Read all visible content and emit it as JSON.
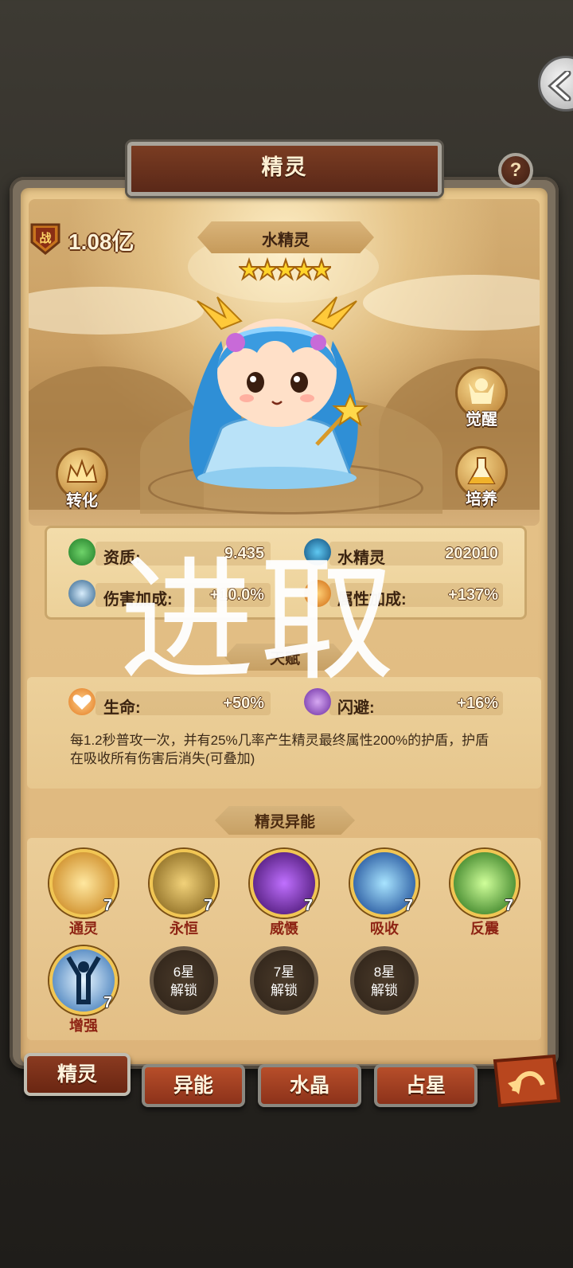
{
  "window": {
    "title": "精灵"
  },
  "power": {
    "badge": "战",
    "value": "1.08亿"
  },
  "spirit": {
    "name": "水精灵",
    "stars": 5
  },
  "side_buttons": {
    "awaken": "觉醒",
    "transform": "转化",
    "cultivate": "培养"
  },
  "stats": {
    "aptitude_label": "资质:",
    "aptitude_value": "9.435",
    "element_label": "水精灵",
    "element_value": "202010",
    "damage_label": "伤害加成:",
    "damage_value": "+10.0%",
    "attribute_label": "属性加成:",
    "attribute_value": "+137%"
  },
  "talent": {
    "title": "天赋",
    "hp_label": "生命:",
    "hp_value": "+50%",
    "dodge_label": "闪避:",
    "dodge_value": "+16%",
    "description": "每1.2秒普攻一次，并有25%几率产生精灵最终属性200%的护盾，护盾在吸收所有伤害后消失(可叠加)"
  },
  "skills": {
    "title": "精灵异能",
    "items": [
      {
        "name": "通灵",
        "level": "7",
        "icon": "magic-circle-icon",
        "color": "#e3a21c"
      },
      {
        "name": "永恒",
        "level": "7",
        "icon": "golden-helmet-icon",
        "color": "#9a7a26"
      },
      {
        "name": "威慑",
        "level": "7",
        "icon": "demon-icon",
        "color": "#6a1fa0"
      },
      {
        "name": "吸收",
        "level": "7",
        "icon": "blue-sword-icon",
        "color": "#1f5fc8"
      },
      {
        "name": "反震",
        "level": "7",
        "icon": "green-blade-icon",
        "color": "#3c9b1e"
      },
      {
        "name": "增强",
        "level": "7",
        "icon": "empower-figure-icon",
        "color": "#4b8fd8"
      }
    ],
    "locked": [
      {
        "line1": "6星",
        "line2": "解锁"
      },
      {
        "line1": "7星",
        "line2": "解锁"
      },
      {
        "line1": "8星",
        "line2": "解锁"
      }
    ]
  },
  "tabs": [
    "精灵",
    "异能",
    "水晶",
    "占星"
  ],
  "watermark": "进取"
}
